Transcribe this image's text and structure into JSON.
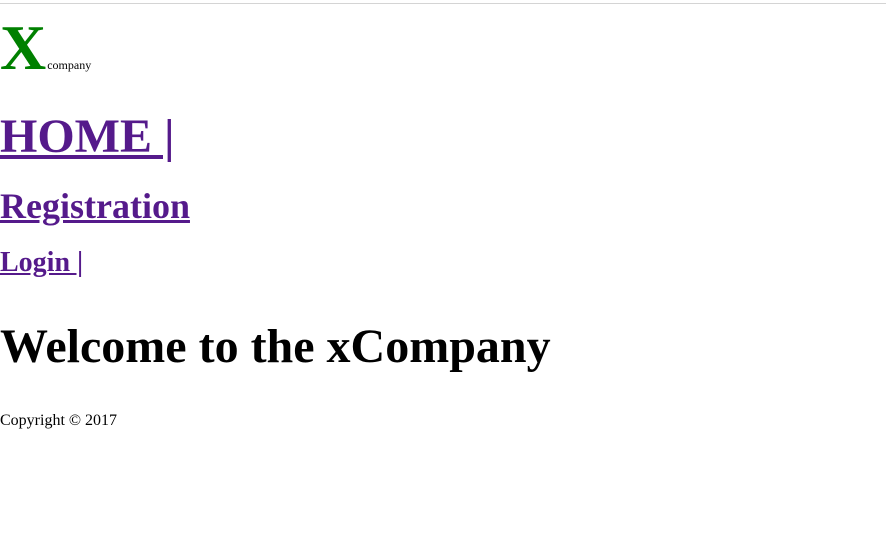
{
  "header": {
    "logo_letter": "X",
    "logo_subtitle": "company",
    "logo_letter_color": "#008000"
  },
  "nav": {
    "link_color": "#551a8b",
    "home": "HOME |",
    "registration": "Registration",
    "login": "Login |"
  },
  "main": {
    "welcome": "Welcome to the xCompany"
  },
  "footer": {
    "copyright": "Copyright © 2017"
  }
}
